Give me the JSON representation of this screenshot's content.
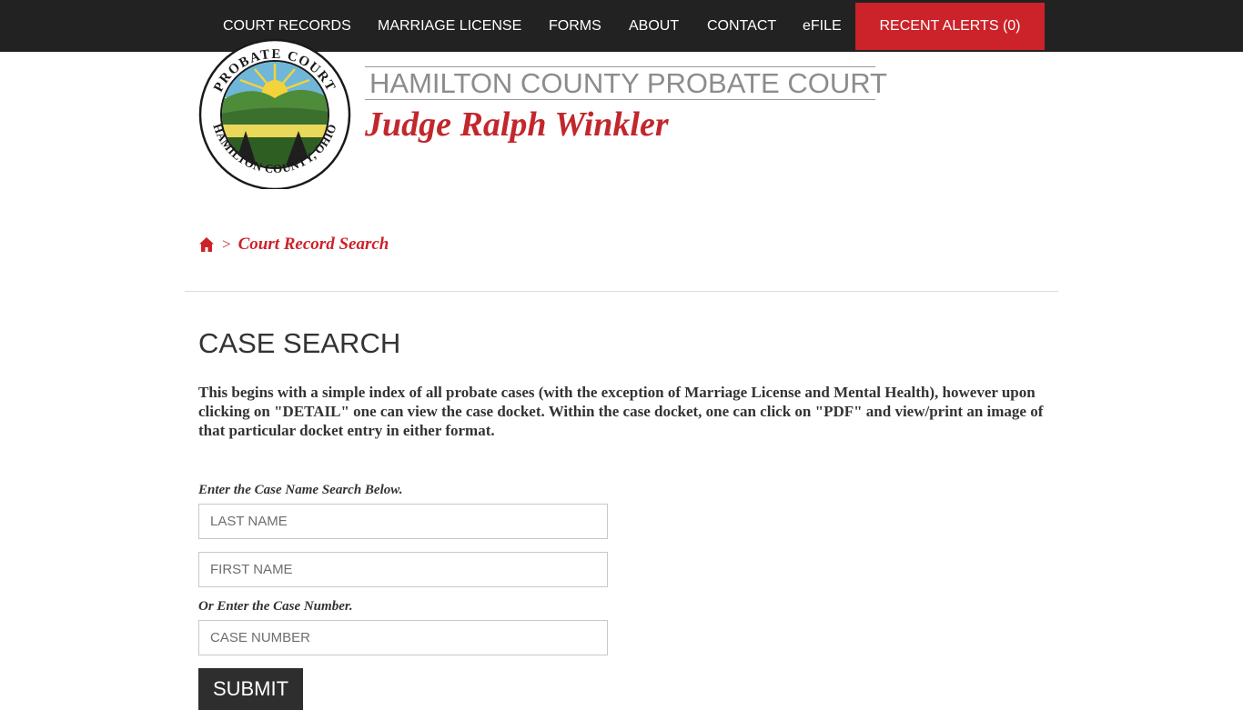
{
  "colors": {
    "nav_bg": "#222222",
    "accent_red": "#cc2229",
    "judge_red": "#c1272d",
    "submit_bg": "#2e2e2e"
  },
  "nav": {
    "items": [
      {
        "label": "COURT RECORDS"
      },
      {
        "label": "MARRIAGE LICENSE"
      },
      {
        "label": "FORMS"
      },
      {
        "label": "ABOUT"
      },
      {
        "label": "CONTACT"
      },
      {
        "label": "eFILE"
      }
    ],
    "alerts_label": "RECENT ALERTS (0)"
  },
  "header": {
    "seal_top_text": "PROBATE COURT",
    "seal_bottom_text": "HAMILTON COUNTY, OHIO",
    "court_title": "HAMILTON COUNTY PROBATE COURT",
    "judge_name": "Judge Ralph Winkler"
  },
  "breadcrumb": {
    "home_icon": "home-icon",
    "separator": ">",
    "current": "Court Record Search"
  },
  "main": {
    "title": "CASE SEARCH",
    "description": "This begins with a simple index of all probate cases (with the exception of Marriage License and Mental Health), however upon clicking on \"DETAIL\" one can view the case docket. Within the case docket, one can click on \"PDF\" and view/print an image of that particular docket entry in either format."
  },
  "form": {
    "name_label": "Enter the Case Name Search Below.",
    "last_name_placeholder": "LAST NAME",
    "first_name_placeholder": "FIRST NAME",
    "case_label": "Or Enter the Case Number.",
    "case_number_placeholder": "CASE NUMBER",
    "submit_label": "SUBMIT"
  }
}
